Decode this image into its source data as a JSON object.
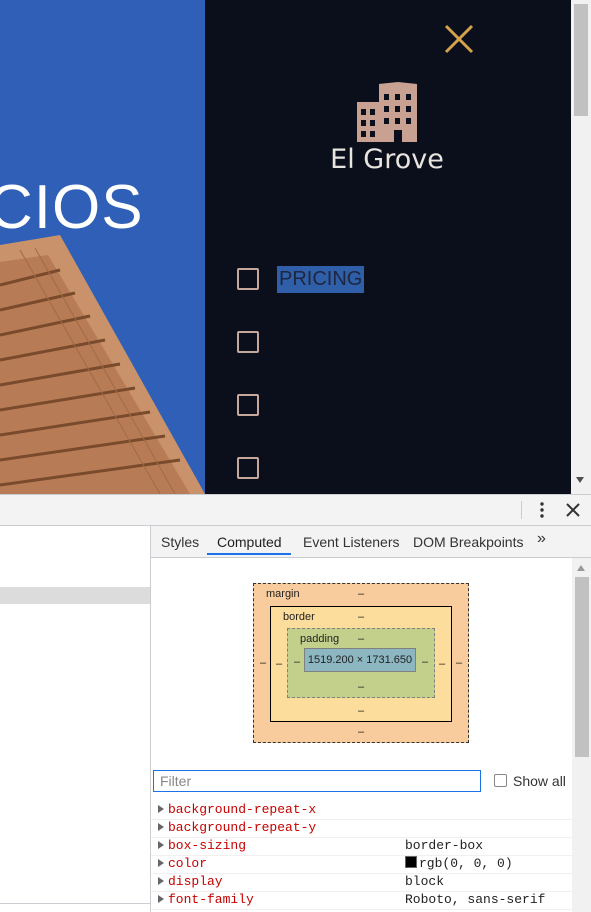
{
  "page": {
    "hero_text": "CIOS",
    "brand_name": "El Grove",
    "menu_items": [
      {
        "label": "PRICING",
        "selected": true
      },
      {
        "label": ""
      },
      {
        "label": ""
      },
      {
        "label": ""
      }
    ],
    "icons": {
      "close": "close-icon",
      "logo": "building-icon"
    }
  },
  "devtools": {
    "tabs": [
      "Styles",
      "Computed",
      "Event Listeners",
      "DOM Breakpoints"
    ],
    "active_tab": "Computed",
    "overflow": "»",
    "box_model": {
      "margin_label": "margin",
      "border_label": "border",
      "padding_label": "padding",
      "content_size": "1519.200 × 1731.650",
      "dash": "–"
    },
    "filter_placeholder": "Filter",
    "show_all_label": "Show all",
    "properties": [
      {
        "name": "background-repeat-x",
        "value": ""
      },
      {
        "name": "background-repeat-y",
        "value": ""
      },
      {
        "name": "box-sizing",
        "value": "border-box"
      },
      {
        "name": "color",
        "value": "rgb(0, 0, 0)",
        "swatch": "#000000"
      },
      {
        "name": "display",
        "value": "block"
      },
      {
        "name": "font-family",
        "value": "Roboto, sans-serif"
      }
    ]
  },
  "colors": {
    "hero_blue": "#2f5fb6",
    "menu_bg": "#0b0f1c",
    "accent_gold": "#d4a24a",
    "logo_tan": "#c9a193",
    "devtools_blue": "#1a73e8"
  }
}
